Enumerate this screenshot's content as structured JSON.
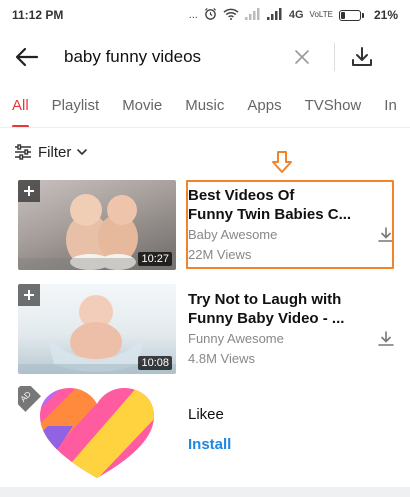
{
  "status_bar": {
    "time": "11:12 PM",
    "dots": "...",
    "network": "4G",
    "volte": "VoLTE",
    "battery_percent": "21%",
    "battery_level": 0.21
  },
  "search": {
    "query": "baby funny videos"
  },
  "tabs": [
    {
      "label": "All",
      "active": true
    },
    {
      "label": "Playlist"
    },
    {
      "label": "Movie"
    },
    {
      "label": "Music"
    },
    {
      "label": "Apps"
    },
    {
      "label": "TVShow"
    },
    {
      "label": "In"
    }
  ],
  "filter": {
    "label": "Filter"
  },
  "videos": [
    {
      "title": "Best Videos Of\nFunny Twin Babies C...",
      "channel": "Baby Awesome",
      "views": "22M Views",
      "duration": "10:27"
    },
    {
      "title": "Try Not to Laugh with\nFunny Baby Video - ...",
      "channel": "Funny Awesome",
      "views": "4.8M Views",
      "duration": "10:08"
    }
  ],
  "ad": {
    "badge": "AD",
    "app_name": "Likee",
    "install_label": "Install"
  },
  "colors": {
    "accent": "#e53935",
    "highlight": "#f0842c",
    "install": "#1e88e5"
  }
}
